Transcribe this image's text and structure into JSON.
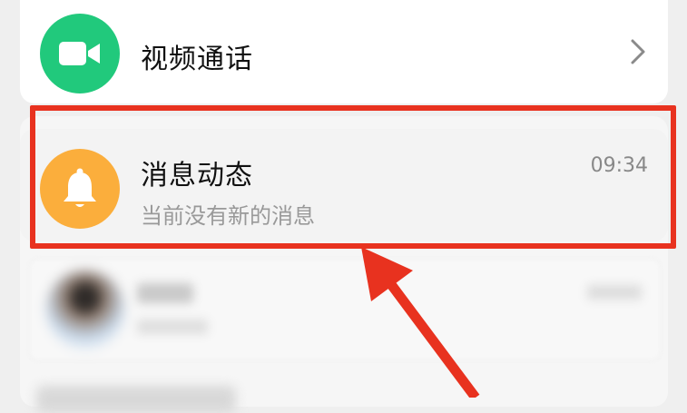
{
  "colors": {
    "video_green": "#21c97c",
    "bell_orange": "#fbae3c",
    "highlight_red": "#e8321f"
  },
  "video_call": {
    "icon": "video-camera-icon",
    "title": "视频通话",
    "chevron_icon": "chevron-right-icon"
  },
  "message_updates": {
    "icon": "bell-icon",
    "title": "消息动态",
    "subtitle": "当前没有新的消息",
    "time": "09:34"
  }
}
